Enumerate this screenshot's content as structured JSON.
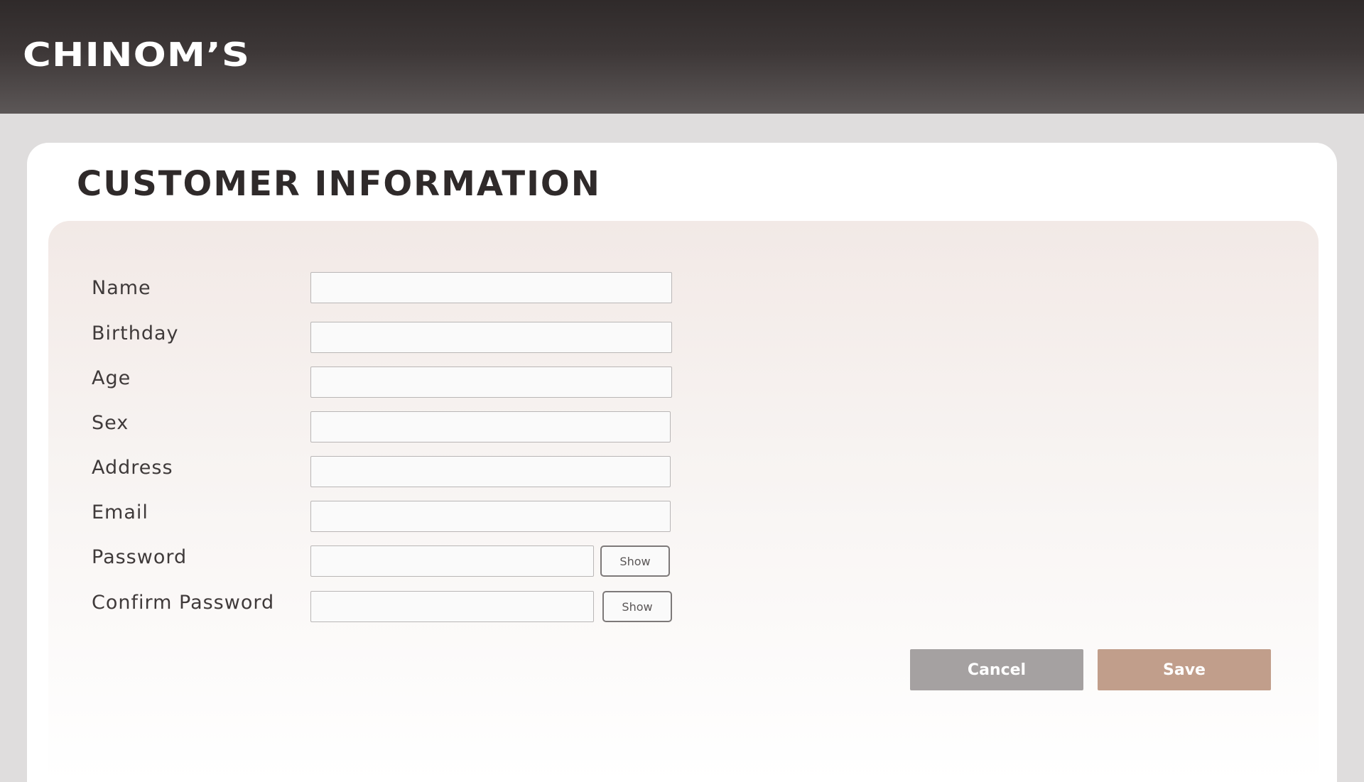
{
  "header": {
    "brand": "CHINOM’S"
  },
  "page": {
    "title": "CUSTOMER INFORMATION"
  },
  "form": {
    "fields": [
      {
        "label": "Name",
        "value": ""
      },
      {
        "label": "Birthday",
        "value": ""
      },
      {
        "label": "Age",
        "value": ""
      },
      {
        "label": "Sex",
        "value": ""
      },
      {
        "label": "Address",
        "value": ""
      },
      {
        "label": "Email",
        "value": ""
      },
      {
        "label": "Password",
        "value": "",
        "toggle_label": "Show"
      },
      {
        "label": "Confirm Password",
        "value": "",
        "toggle_label": "Show"
      }
    ]
  },
  "actions": {
    "cancel_label": "Cancel",
    "save_label": "Save"
  },
  "colors": {
    "header_dark": "#2f2a2a",
    "cancel_button": "#a5a1a1",
    "save_button": "#c19e8b",
    "panel_tint": "#f2e9e6"
  }
}
